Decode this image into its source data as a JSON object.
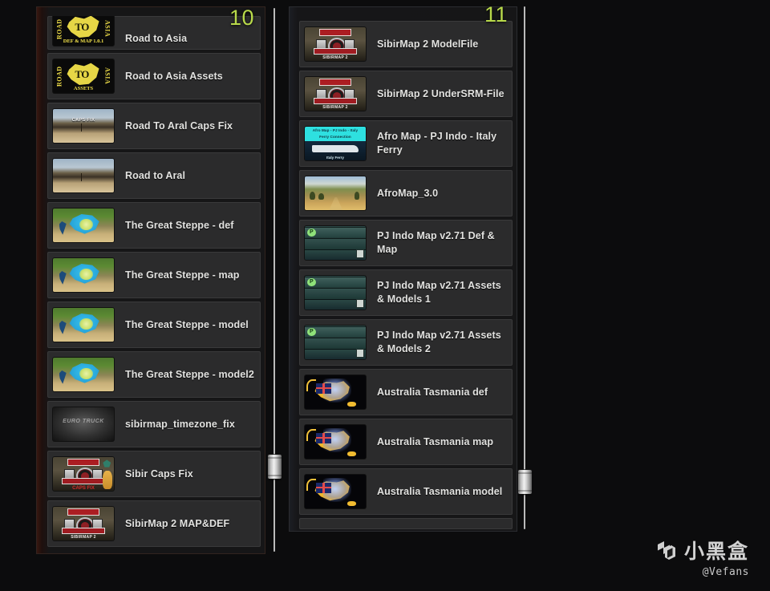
{
  "page": {
    "background_color": "#0c0c0d",
    "accent_color": "#b8d94a"
  },
  "left_panel": {
    "page_number": "10",
    "scrollbar": {
      "name": "vertical-scrollbar",
      "thumb_position_percent": 86
    },
    "items": [
      {
        "label": "Road to Asia",
        "thumb": "road-to-asia-def-map",
        "partial_top": true
      },
      {
        "label": "Road to Asia Assets",
        "thumb": "road-to-asia-assets"
      },
      {
        "label": "Road To Aral Caps Fix",
        "thumb": "desert-caps-fix"
      },
      {
        "label": "Road to Aral",
        "thumb": "desert"
      },
      {
        "label": "The Great Steppe - def",
        "thumb": "steppe"
      },
      {
        "label": "The Great Steppe - map",
        "thumb": "steppe"
      },
      {
        "label": "The Great Steppe - model",
        "thumb": "steppe"
      },
      {
        "label": "The Great Steppe - model2",
        "thumb": "steppe"
      },
      {
        "label": "sibirmap_timezone_fix",
        "thumb": "grey-truck"
      },
      {
        "label": "Sibir Caps Fix",
        "thumb": "sibir-caps-fix"
      },
      {
        "label": "SibirMap 2 MAP&DEF",
        "thumb": "sibir"
      }
    ],
    "thumb_text": {
      "road_to_asia": {
        "left": "ROAD",
        "right": "ASIA",
        "center": "TO",
        "sub": "DEF & MAP  1.0.1"
      },
      "road_to_asia_assets": {
        "left": "ROAD",
        "right": "ASIA",
        "center": "TO",
        "sub": "ASSETS"
      },
      "caps_fix": "CAPS FIX",
      "grey_truck": "EURO TRUCK",
      "sibir_caps": {
        "top": "SIBIR 2",
        "bottom": "CAPS FIX"
      },
      "sibir": {
        "top": "SIBIR 2",
        "bottom": "SIBIRMAP 2"
      }
    }
  },
  "right_panel": {
    "page_number": "11",
    "scrollbar": {
      "name": "vertical-scrollbar",
      "thumb_position_percent": 93
    },
    "items": [
      {
        "label": "SibirMap 2 ModelFile",
        "thumb": "sibir"
      },
      {
        "label": "SibirMap 2 UnderSRM-File",
        "thumb": "sibir"
      },
      {
        "label": "Afro Map - PJ Indo - Italy Ferry",
        "thumb": "afro-ferry"
      },
      {
        "label": "AfroMap_3.0",
        "thumb": "afromap3"
      },
      {
        "label": "PJ Indo Map v2.71 Def & Map",
        "thumb": "pj-indo"
      },
      {
        "label": "PJ Indo Map v2.71 Assets & Models 1",
        "thumb": "pj-indo"
      },
      {
        "label": "PJ Indo Map v2.71 Assets & Models 2",
        "thumb": "pj-indo"
      },
      {
        "label": "Australia Tasmania def",
        "thumb": "australia"
      },
      {
        "label": "Australia Tasmania map",
        "thumb": "australia"
      },
      {
        "label": "Australia Tasmania model",
        "thumb": "australia"
      }
    ],
    "thumb_text": {
      "afro_ferry": {
        "line1": "Afro Map - PJ Indo - Italy",
        "line2": "Ferry Connection",
        "caption": "Italy Ferry"
      },
      "pj_indo": {
        "logo": "P"
      }
    }
  },
  "watermark": {
    "brand": "小黑盒",
    "handle": "@Vefans"
  }
}
